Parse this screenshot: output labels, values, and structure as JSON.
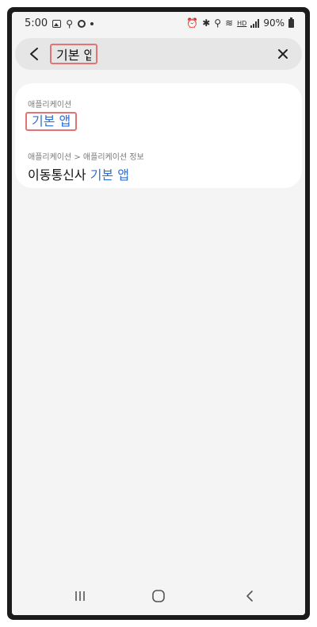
{
  "status_bar": {
    "time": "5:00",
    "hd_label": "HD",
    "battery": "90%"
  },
  "search": {
    "query": "기본 앱"
  },
  "results": [
    {
      "breadcrumb": "애플리케이션",
      "title_prefix": "",
      "title_highlight": "기본 앱"
    },
    {
      "breadcrumb": "애플리케이션 > 애플리케이션 정보",
      "title_prefix": "이동통신사 ",
      "title_highlight": "기본 앱"
    }
  ],
  "colors": {
    "highlight": "#2f6fd6",
    "annotation_box": "#e57373"
  },
  "icons": {
    "back": "chevron-left-icon",
    "clear": "close-icon",
    "nav_recent": "recent-apps-icon",
    "nav_home": "home-icon",
    "nav_back": "back-icon"
  }
}
